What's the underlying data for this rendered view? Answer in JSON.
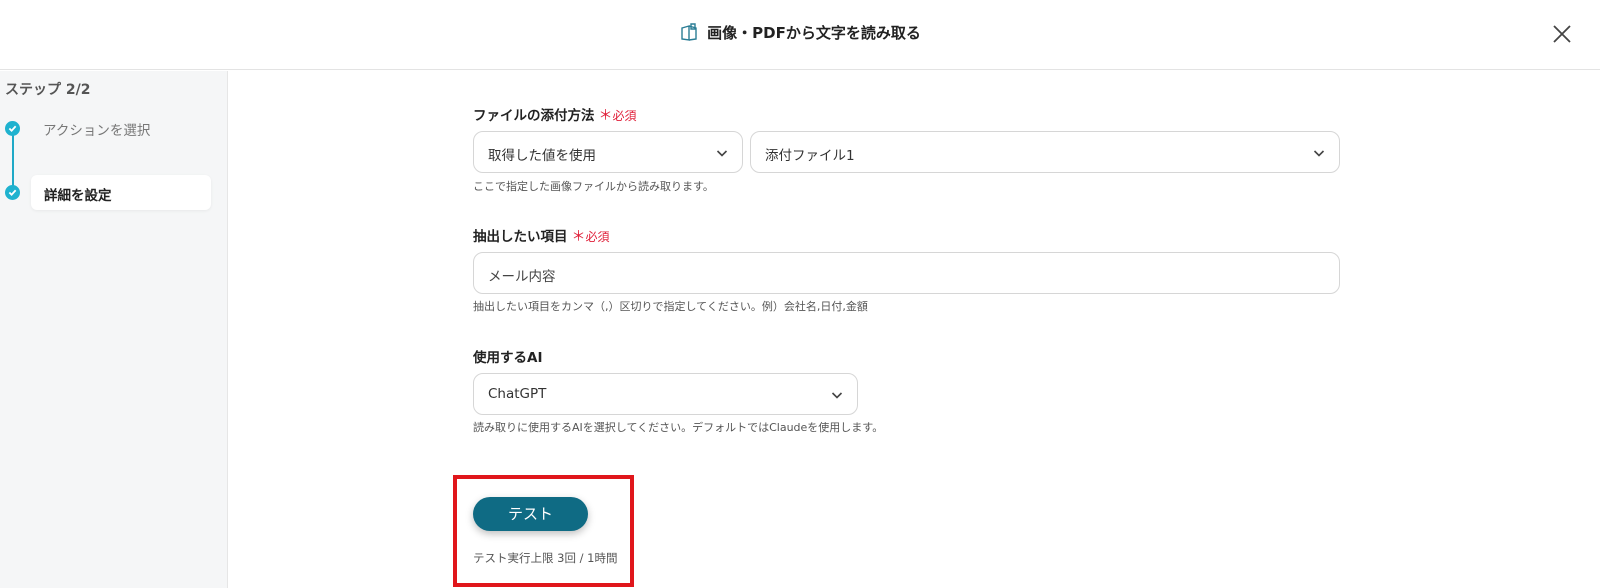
{
  "header": {
    "title": "画像・PDFから文字を読み取る",
    "title_icon": "ocr-document-icon",
    "close_icon": "close-icon"
  },
  "sidebar": {
    "step_label": "ステップ 2/2",
    "steps": [
      {
        "label": "アクションを選択",
        "state": "done"
      },
      {
        "label": "詳細を設定",
        "state": "active"
      }
    ]
  },
  "fields": {
    "attach": {
      "label": "ファイルの添付方法",
      "required": "必須",
      "method_value": "取得した値を使用",
      "file_value": "添付ファイル1",
      "help": "ここで指定した画像ファイルから読み取ります。"
    },
    "extract": {
      "label": "抽出したい項目",
      "required": "必須",
      "value": "メール内容",
      "help": "抽出したい項目をカンマ（,）区切りで指定してください。例）会社名,日付,金額"
    },
    "ai": {
      "label": "使用するAI",
      "value": "ChatGPT",
      "help": "読み取りに使用するAIを選択してください。デフォルトではClaudeを使用します。"
    }
  },
  "test": {
    "button_label": "テスト",
    "limit_text": "テスト実行上限 3回 / 1時間"
  },
  "colors": {
    "accent": "#1fb2cf",
    "button": "#0f6b84",
    "required": "#e0203a",
    "highlight": "#e0161b"
  }
}
